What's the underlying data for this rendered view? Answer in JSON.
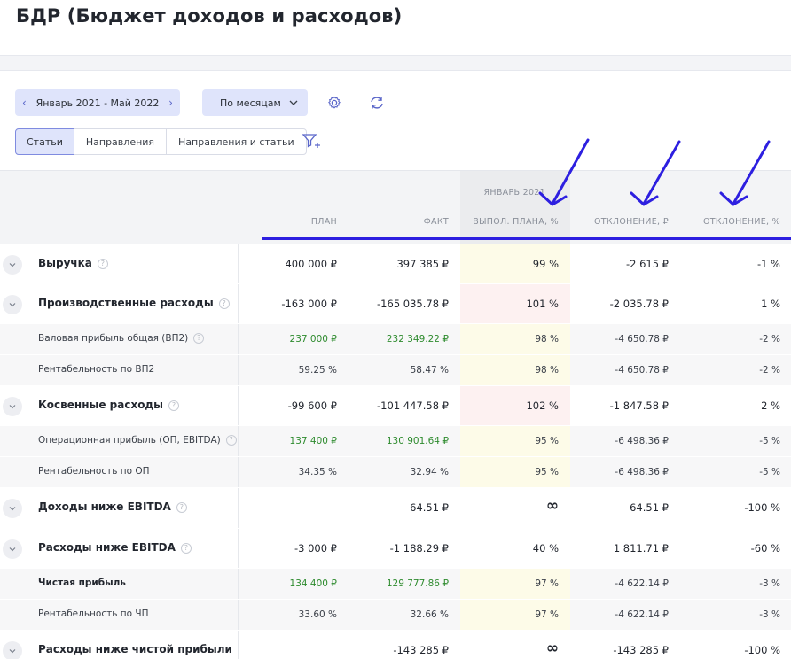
{
  "page": {
    "title": "БДР (Бюджет доходов и расходов)"
  },
  "toolbar": {
    "period_label": "Январь 2021 - Май 2022",
    "grouping_label": "По месяцам",
    "segments": [
      "Статьи",
      "Направления",
      "Направления и статьи"
    ]
  },
  "table": {
    "group_header": "ЯНВАРЬ 2021",
    "columns": [
      "ПЛАН",
      "ФАКТ",
      "ВЫПОЛ. ПЛАНА, %",
      "ОТКЛОНЕНИЕ, ₽",
      "ОТКЛОНЕНИЕ, %"
    ],
    "rows": [
      {
        "label": "Выручка",
        "plan": "400 000 ₽",
        "fact": "397 385 ₽",
        "pct": "99 %",
        "dev": "-2 615 ₽",
        "devp": "-1 %"
      },
      {
        "label": "Производственные расходы",
        "plan": "-163 000 ₽",
        "fact": "-165 035.78 ₽",
        "pct": "101 %",
        "dev": "-2 035.78 ₽",
        "devp": "1 %"
      },
      {
        "label": "Валовая прибыль общая (ВП2)",
        "plan": "237 000 ₽",
        "fact": "232 349.22 ₽",
        "pct": "98 %",
        "dev": "-4 650.78 ₽",
        "devp": "-2 %"
      },
      {
        "label": "Рентабельность по ВП2",
        "plan": "59.25 %",
        "fact": "58.47 %",
        "pct": "98 %",
        "dev": "-4 650.78 ₽",
        "devp": "-2 %"
      },
      {
        "label": "Косвенные расходы",
        "plan": "-99 600 ₽",
        "fact": "-101 447.58 ₽",
        "pct": "102 %",
        "dev": "-1 847.58 ₽",
        "devp": "2 %"
      },
      {
        "label": "Операционная прибыль (ОП, EBITDA)",
        "plan": "137 400 ₽",
        "fact": "130 901.64 ₽",
        "pct": "95 %",
        "dev": "-6 498.36 ₽",
        "devp": "-5 %"
      },
      {
        "label": "Рентабельность по ОП",
        "plan": "34.35 %",
        "fact": "32.94 %",
        "pct": "95 %",
        "dev": "-6 498.36 ₽",
        "devp": "-5 %"
      },
      {
        "label": "Доходы ниже EBITDA",
        "plan": "",
        "fact": "64.51 ₽",
        "pct": "∞",
        "dev": "64.51 ₽",
        "devp": "-100 %"
      },
      {
        "label": "Расходы ниже EBITDA",
        "plan": "-3 000 ₽",
        "fact": "-1 188.29 ₽",
        "pct": "40 %",
        "dev": "1 811.71 ₽",
        "devp": "-60 %"
      },
      {
        "label": "Чистая прибыль",
        "plan": "134 400 ₽",
        "fact": "129 777.86 ₽",
        "pct": "97 %",
        "dev": "-4 622.14 ₽",
        "devp": "-3 %"
      },
      {
        "label": "Рентабельность по ЧП",
        "plan": "33.60 %",
        "fact": "32.66 %",
        "pct": "97 %",
        "dev": "-4 622.14 ₽",
        "devp": "-3 %"
      },
      {
        "label": "Расходы ниже чистой прибыли",
        "plan": "",
        "fact": "-143 285 ₽",
        "pct": "∞",
        "dev": "-143 285 ₽",
        "devp": "-100 %"
      }
    ]
  },
  "colors": {
    "accent": "#dfe4fb",
    "annotation": "#2d1fe0",
    "positive": "#2e8b2e"
  },
  "icons": [
    "chevron-left-icon",
    "chevron-right-icon",
    "chevron-down-icon",
    "gear-icon",
    "refresh-icon",
    "filter-add-icon",
    "help-icon",
    "expand-icon",
    "arrow-annotation-icon"
  ]
}
